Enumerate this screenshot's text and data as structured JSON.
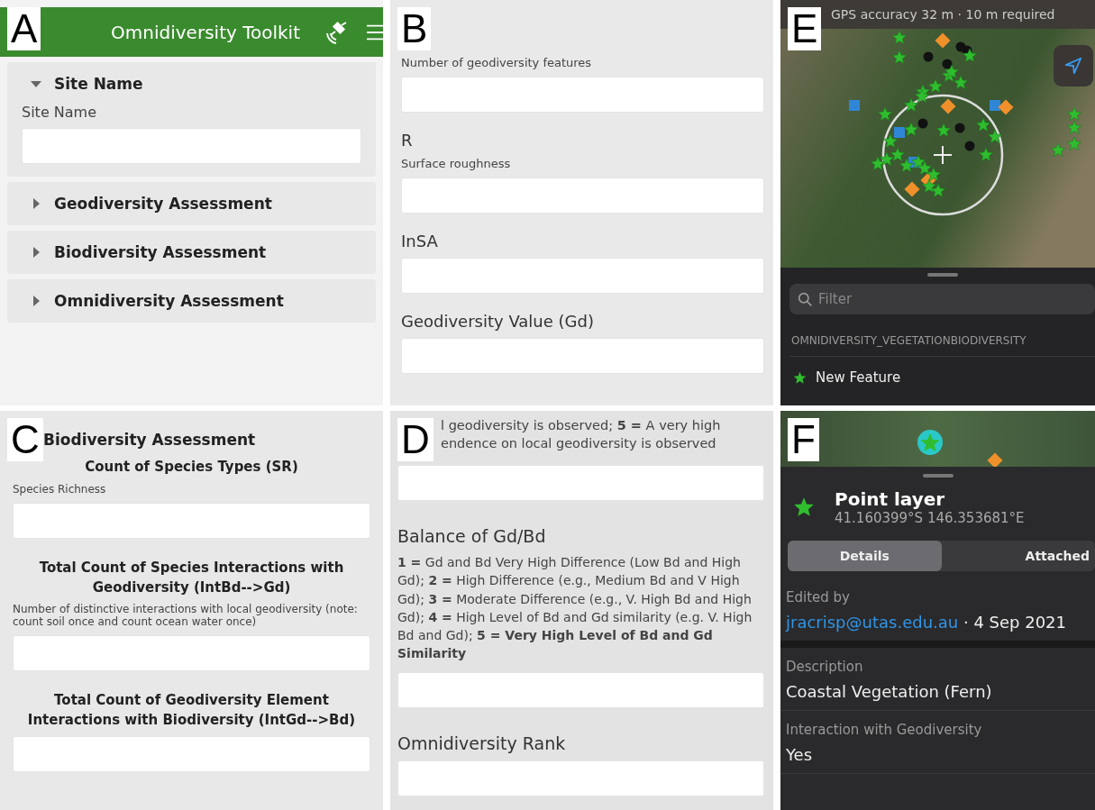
{
  "panel_a": {
    "letter": "A",
    "app_title": "Omnidiversity Toolkit",
    "sections": [
      {
        "title": "Site Name",
        "expanded": true,
        "fields": [
          {
            "label": "Site Name"
          }
        ]
      },
      {
        "title": "Geodiversity Assessment",
        "expanded": false
      },
      {
        "title": "Biodiversity Assessment",
        "expanded": false
      },
      {
        "title": "Omnidiversity Assessment",
        "expanded": false
      }
    ]
  },
  "panel_b": {
    "letter": "B",
    "fields": [
      {
        "description": "Number of geodiversity features"
      },
      {
        "title": "R",
        "description": "Surface roughness"
      },
      {
        "title": "InSA"
      },
      {
        "title": "Geodiversity Value (Gd)"
      }
    ]
  },
  "panel_e": {
    "letter": "E",
    "gps_banner": "GPS accuracy 32 m  ·  10 m required",
    "filter": {
      "placeholder": "Filter"
    },
    "layer_header": "OMNIDIVERSITY_VEGETATIONBIODIVERSITY",
    "features": [
      {
        "name": "New Feature"
      }
    ]
  },
  "panel_c": {
    "letter": "C",
    "section_title": "Biodiversity Assessment",
    "fields": [
      {
        "title": "Count of Species Types (SR)",
        "description": "Species Richness"
      },
      {
        "title": "Total Count of Species Interactions with Geodiversity (IntBd-->Gd)",
        "description": "Number of distinctive interactions with local geodiversity (note: count soil once and count ocean water once)"
      },
      {
        "title": "Total Count of Geodiversity Element Interactions with Biodiversity (IntGd-->Bd)"
      }
    ]
  },
  "panel_d": {
    "letter": "D",
    "partial_description": [
      "l geodiversity is observed; **5 =** A very high",
      "endence on local geodiversity is observed"
    ],
    "fields": [
      {
        "title": "Balance of Gd/Bd",
        "description": "**1 =** Gd and Bd Very High Difference (Low Bd and High Gd); **2 =** High Difference (e.g., Medium Bd and V High Gd); **3 =** Moderate Difference (e.g., V. High Bd and High Gd); **4 =** High Level of Bd and Gd similarity (e.g. V. High Bd and Gd); **5 = Very High Level of Bd and Gd Similarity**"
      },
      {
        "title": "Omnidiversity Rank"
      }
    ]
  },
  "panel_f": {
    "letter": "F",
    "title": "Point layer",
    "coordinates": "41.160399°S  146.353681°E",
    "tabs": [
      {
        "label": "Details",
        "selected": true
      },
      {
        "label": "Attached",
        "selected": false
      }
    ],
    "edited_label": "Edited by",
    "editor": "jracrisp@utas.edu.au",
    "edited_date": "· 4 Sep 2021",
    "attributes": [
      {
        "label": "Description",
        "value": "Coastal Vegetation (Fern)"
      },
      {
        "label": "Interaction with Geodiversity",
        "value": "Yes"
      }
    ]
  }
}
